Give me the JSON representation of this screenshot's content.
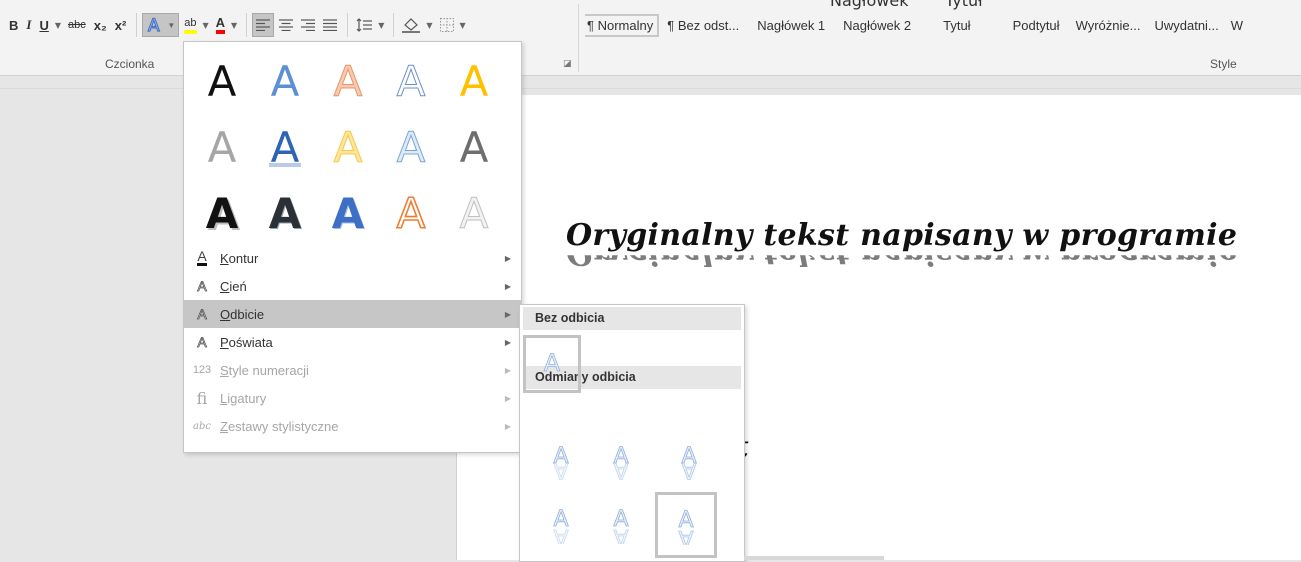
{
  "ribbon": {
    "top_cut": [
      "Nagłówek",
      "Tytuł"
    ],
    "font_group_label": "Czcionka",
    "styles_group_label": "Style",
    "buttons": {
      "bold": "B",
      "italic": "I",
      "underline": "U",
      "strikethrough": "abc",
      "subscript": "x₂",
      "superscript": "x²",
      "highlight": "ab",
      "font_color": "A"
    },
    "styles": [
      "¶ Normalny",
      "¶ Bez odst...",
      "Nagłówek 1",
      "Nagłówek 2",
      "Tytuł",
      "Podtytuł",
      "Wyróżnie...",
      "Uwydatni...",
      "W"
    ]
  },
  "document": {
    "title_text": "Oryginalny tekst napisany w programie",
    "second_text": "st"
  },
  "effects_menu": {
    "gallery_icon": "A",
    "items": [
      {
        "label": "Kontur",
        "icon": "A",
        "disabled": false,
        "highlighted": false
      },
      {
        "label": "Cień",
        "icon": "A",
        "disabled": false,
        "highlighted": false
      },
      {
        "label": "Odbicie",
        "icon": "A",
        "disabled": false,
        "highlighted": true
      },
      {
        "label": "Poświata",
        "icon": "A",
        "disabled": false,
        "highlighted": false
      },
      {
        "label": "Style numeracji",
        "icon": "123",
        "disabled": true,
        "highlighted": false
      },
      {
        "label": "Ligatury",
        "icon": "fi",
        "disabled": true,
        "highlighted": false
      },
      {
        "label": "Zestawy stylistyczne",
        "icon": "abc",
        "disabled": true,
        "highlighted": false
      }
    ]
  },
  "reflection_menu": {
    "no_reflection_header": "Bez odbicia",
    "variations_header": "Odmiany odbicia"
  },
  "colors": {
    "accent_blue": "#4472c4",
    "orange": "#ed7d31",
    "gold": "#ffc000",
    "highlight_yellow": "#ffff00",
    "font_red": "#ff0000",
    "menu_highlight": "#c6c6c6"
  }
}
